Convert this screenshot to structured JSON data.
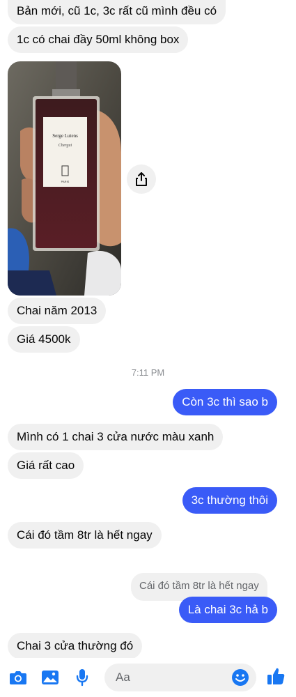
{
  "messages": {
    "m1": "Bản mới, cũ 1c, 3c rất cũ mình đều có",
    "m2": "1c có chai đầy 50ml không box",
    "m3": "Chai năm 2013",
    "m4": "Giá 4500k",
    "m5": "Còn 3c thì sao b",
    "m6": "Mình có 1 chai 3 cửa nước màu xanh",
    "m7": "Giá rất cao",
    "m8": "3c thường thôi",
    "m9": "Cái đó tầm 8tr là hết ngay",
    "m10": "Là chai 3c hả b",
    "m11": "Chai 3 cửa thường đó"
  },
  "timestamp": "7:11 PM",
  "reply_quote": "Cái đó tầm 8tr là hết ngay",
  "photo": {
    "label_brand": "Serge Lutens",
    "label_name": "Chergui",
    "label_city": "PARIS"
  },
  "composer": {
    "placeholder": "Aa",
    "icons": [
      "camera-icon",
      "image-icon",
      "microphone-icon",
      "emoji-icon",
      "thumbs-up-icon"
    ]
  },
  "colors": {
    "outgoing": "#3a5bf7",
    "incoming": "#f0f0f0",
    "accent": "#1877f2"
  }
}
